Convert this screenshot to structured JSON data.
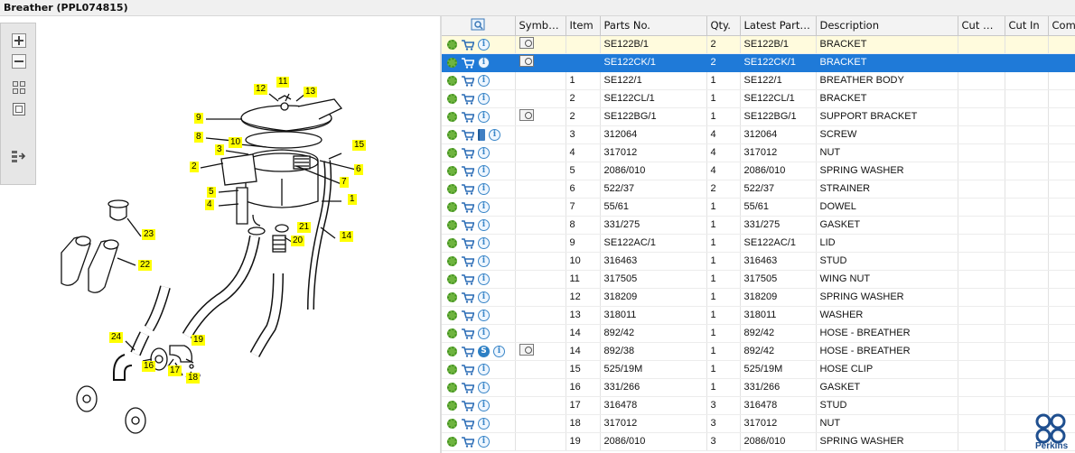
{
  "window": {
    "title": "Breather (PPL074815)"
  },
  "toolbar": {
    "buttons": [
      {
        "name": "zoom-in-icon",
        "glyph": "+"
      },
      {
        "name": "zoom-out-icon",
        "glyph": "−"
      },
      {
        "name": "fit-all-icon",
        "glyph": "▦"
      },
      {
        "name": "actual-size-icon",
        "glyph": "▢"
      },
      {
        "name": "export-list-icon",
        "glyph": "⇨"
      }
    ]
  },
  "grid": {
    "headers": {
      "icons": "",
      "symbols": "Symbol...",
      "item": "Item",
      "parts_no": "Parts No.",
      "qty": "Qty.",
      "latest_part_no": "Latest Part No.",
      "description": "Description",
      "cut_out": "Cut Out",
      "cut_in": "Cut In",
      "comment": "Comment"
    },
    "rows": [
      {
        "item": "",
        "parts_no": "SE122B/1",
        "qty": "2",
        "latest": "SE122B/1",
        "description": "BRACKET",
        "extra": "",
        "symbol": true,
        "state": "yellow"
      },
      {
        "item": "",
        "parts_no": "SE122CK/1",
        "qty": "2",
        "latest": "SE122CK/1",
        "description": "BRACKET",
        "extra": "",
        "symbol": true,
        "state": "selected"
      },
      {
        "item": "1",
        "parts_no": "SE122/1",
        "qty": "1",
        "latest": "SE122/1",
        "description": "BREATHER BODY",
        "extra": "",
        "symbol": false,
        "state": ""
      },
      {
        "item": "2",
        "parts_no": "SE122CL/1",
        "qty": "1",
        "latest": "SE122CL/1",
        "description": "BRACKET",
        "extra": "",
        "symbol": false,
        "state": ""
      },
      {
        "item": "2",
        "parts_no": "SE122BG/1",
        "qty": "1",
        "latest": "SE122BG/1",
        "description": "SUPPORT BRACKET",
        "extra": "",
        "symbol": true,
        "state": ""
      },
      {
        "item": "3",
        "parts_no": "312064",
        "qty": "4",
        "latest": "312064",
        "description": "SCREW",
        "extra": "book",
        "symbol": false,
        "state": ""
      },
      {
        "item": "4",
        "parts_no": "317012",
        "qty": "4",
        "latest": "317012",
        "description": "NUT",
        "extra": "",
        "symbol": false,
        "state": ""
      },
      {
        "item": "5",
        "parts_no": "2086/010",
        "qty": "4",
        "latest": "2086/010",
        "description": "SPRING WASHER",
        "extra": "",
        "symbol": false,
        "state": ""
      },
      {
        "item": "6",
        "parts_no": "522/37",
        "qty": "2",
        "latest": "522/37",
        "description": "STRAINER",
        "extra": "",
        "symbol": false,
        "state": ""
      },
      {
        "item": "7",
        "parts_no": "55/61",
        "qty": "1",
        "latest": "55/61",
        "description": "DOWEL",
        "extra": "",
        "symbol": false,
        "state": ""
      },
      {
        "item": "8",
        "parts_no": "331/275",
        "qty": "1",
        "latest": "331/275",
        "description": "GASKET",
        "extra": "",
        "symbol": false,
        "state": ""
      },
      {
        "item": "9",
        "parts_no": "SE122AC/1",
        "qty": "1",
        "latest": "SE122AC/1",
        "description": "LID",
        "extra": "",
        "symbol": false,
        "state": ""
      },
      {
        "item": "10",
        "parts_no": "316463",
        "qty": "1",
        "latest": "316463",
        "description": "STUD",
        "extra": "",
        "symbol": false,
        "state": ""
      },
      {
        "item": "11",
        "parts_no": "317505",
        "qty": "1",
        "latest": "317505",
        "description": "WING NUT",
        "extra": "",
        "symbol": false,
        "state": ""
      },
      {
        "item": "12",
        "parts_no": "318209",
        "qty": "1",
        "latest": "318209",
        "description": "SPRING WASHER",
        "extra": "",
        "symbol": false,
        "state": ""
      },
      {
        "item": "13",
        "parts_no": "318011",
        "qty": "1",
        "latest": "318011",
        "description": "WASHER",
        "extra": "",
        "symbol": false,
        "state": ""
      },
      {
        "item": "14",
        "parts_no": "892/42",
        "qty": "1",
        "latest": "892/42",
        "description": "HOSE - BREATHER",
        "extra": "",
        "symbol": false,
        "state": ""
      },
      {
        "item": "14",
        "parts_no": "892/38",
        "qty": "1",
        "latest": "892/42",
        "description": "HOSE - BREATHER",
        "extra": "S",
        "symbol": true,
        "state": ""
      },
      {
        "item": "15",
        "parts_no": "525/19M",
        "qty": "1",
        "latest": "525/19M",
        "description": "HOSE CLIP",
        "extra": "",
        "symbol": false,
        "state": ""
      },
      {
        "item": "16",
        "parts_no": "331/266",
        "qty": "1",
        "latest": "331/266",
        "description": "GASKET",
        "extra": "",
        "symbol": false,
        "state": ""
      },
      {
        "item": "17",
        "parts_no": "316478",
        "qty": "3",
        "latest": "316478",
        "description": "STUD",
        "extra": "",
        "symbol": false,
        "state": ""
      },
      {
        "item": "18",
        "parts_no": "317012",
        "qty": "3",
        "latest": "317012",
        "description": "NUT",
        "extra": "",
        "symbol": false,
        "state": ""
      },
      {
        "item": "19",
        "parts_no": "2086/010",
        "qty": "3",
        "latest": "2086/010",
        "description": "SPRING WASHER",
        "extra": "",
        "symbol": false,
        "state": ""
      }
    ]
  },
  "diagram": {
    "callouts": [
      "1",
      "2",
      "3",
      "4",
      "5",
      "6",
      "7",
      "8",
      "9",
      "10",
      "11",
      "12",
      "13",
      "14",
      "15",
      "16",
      "17",
      "18",
      "19",
      "20",
      "21",
      "22",
      "23",
      "24"
    ]
  },
  "brand": {
    "name": "Perkins",
    "color": "#1f4f8f"
  },
  "colors": {
    "selected": "#1f7ad8",
    "highlight": "#fffbdd",
    "callout": "#ffff00"
  }
}
